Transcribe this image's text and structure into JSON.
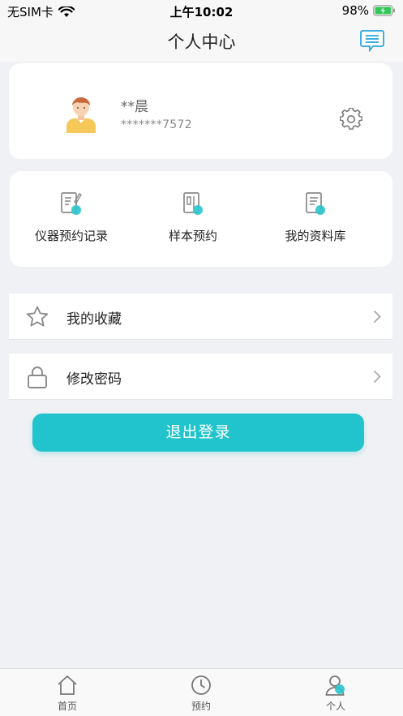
{
  "status_bar": {
    "carrier": "无SIM卡",
    "time": "上午10:02",
    "battery": "98%"
  },
  "header": {
    "title": "个人中心",
    "message_icon": "message-list-icon"
  },
  "profile": {
    "name": "**晨",
    "phone": "*******7572",
    "avatar_icon": "user-avatar",
    "settings_icon": "gear-icon"
  },
  "shortcuts": [
    {
      "label": "仪器预约记录",
      "icon": "document-edit-icon"
    },
    {
      "label": "样本预约",
      "icon": "sample-book-icon"
    },
    {
      "label": "我的资料库",
      "icon": "document-check-icon"
    }
  ],
  "menu": [
    {
      "label": "我的收藏",
      "icon": "star-icon"
    },
    {
      "label": "修改密码",
      "icon": "lock-icon"
    }
  ],
  "logout_label": "退出登录",
  "tabs": [
    {
      "label": "首页",
      "icon": "home-icon"
    },
    {
      "label": "预约",
      "icon": "clock-icon"
    },
    {
      "label": "个人",
      "icon": "person-icon",
      "active": true
    }
  ],
  "colors": {
    "accent": "#21c4cc",
    "background": "#eff1f4",
    "icon_gray": "#8a8a8a"
  }
}
